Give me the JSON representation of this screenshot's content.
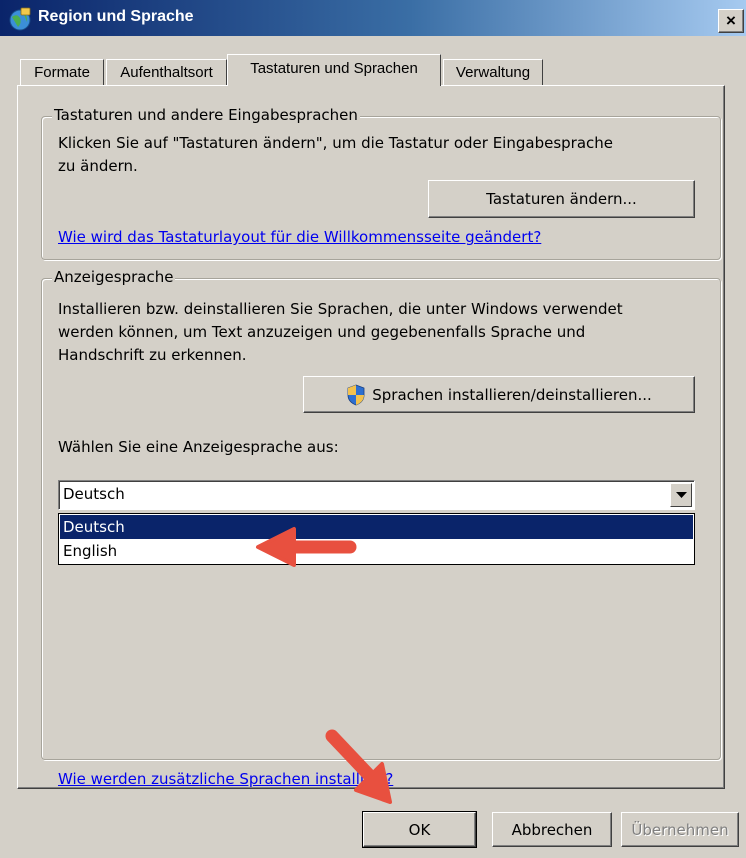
{
  "window": {
    "title": "Region und Sprache",
    "close_label": "×"
  },
  "tabs": [
    {
      "label": "Formate",
      "active": false
    },
    {
      "label": "Aufenthaltsort",
      "active": false
    },
    {
      "label": "Tastaturen und Sprachen",
      "active": true
    },
    {
      "label": "Verwaltung",
      "active": false
    }
  ],
  "keyboards_group": {
    "legend": "Tastaturen und andere Eingabesprachen",
    "description_line1": "Klicken Sie auf \"Tastaturen ändern\", um die Tastatur oder Eingabesprache",
    "description_line2": "zu ändern.",
    "change_button": "Tastaturen ändern...",
    "welcome_link": "Wie wird das Tastaturlayout für die Willkommensseite geändert?"
  },
  "display_group": {
    "legend": "Anzeigesprache",
    "description_line1": "Installieren bzw. deinstallieren Sie Sprachen, die unter Windows verwendet",
    "description_line2": "werden können, um Text anzuzeigen und gegebenenfalls Sprache und",
    "description_line3": "Handschrift zu erkennen.",
    "install_button": "Sprachen installieren/deinstallieren...",
    "select_label": "Wählen Sie eine Anzeigesprache aus:",
    "selected_language": "Deutsch",
    "options": [
      "Deutsch",
      "English"
    ],
    "highlighted_option": "Deutsch"
  },
  "footer_link": "Wie werden zusätzliche Sprachen installiert?",
  "buttons": {
    "ok": "OK",
    "cancel": "Abbrechen",
    "apply": "Übernehmen"
  },
  "colors": {
    "annotation_arrow": "#e8503f",
    "selection": "#0a246a",
    "link": "#0000ee"
  }
}
